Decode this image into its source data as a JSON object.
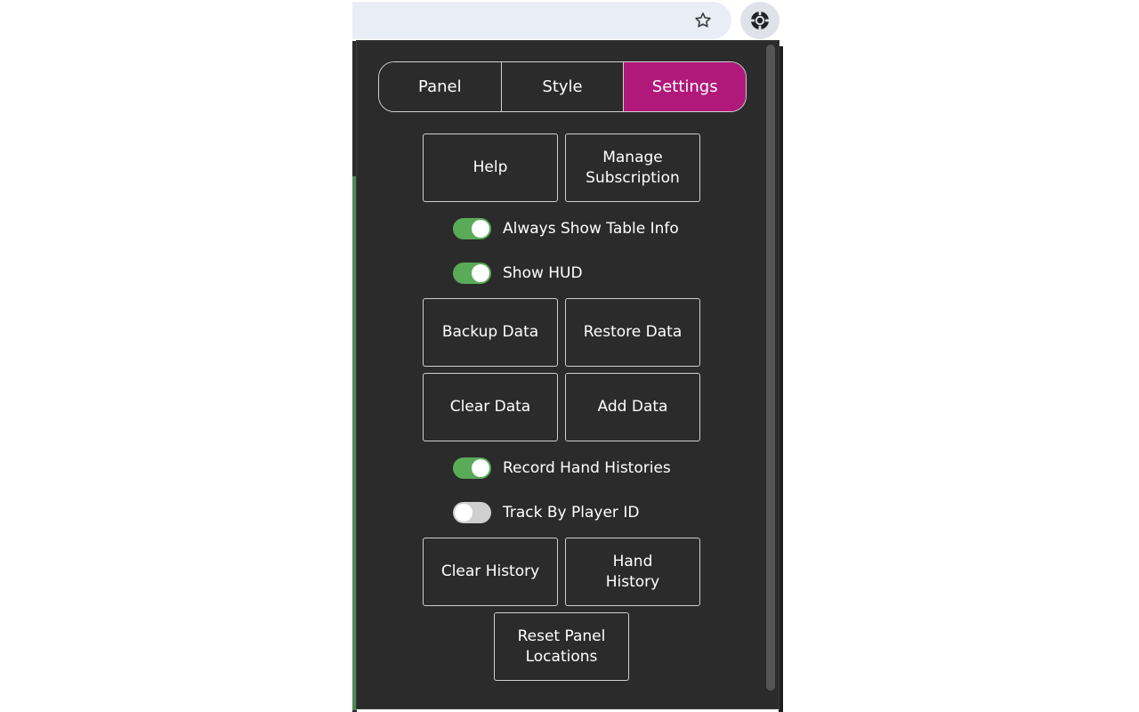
{
  "tabs": [
    {
      "label": "Panel",
      "active": false
    },
    {
      "label": "Style",
      "active": false
    },
    {
      "label": "Settings",
      "active": true
    }
  ],
  "buttons": {
    "help": "Help",
    "manage_subscription": "Manage\nSubscription",
    "backup_data": "Backup Data",
    "restore_data": "Restore Data",
    "clear_data": "Clear Data",
    "add_data": "Add Data",
    "clear_history": "Clear History",
    "hand_history": "Hand\nHistory",
    "reset_panel_locations": "Reset Panel\nLocations"
  },
  "toggles": {
    "always_show_table_info": {
      "label": "Always Show Table Info",
      "on": true
    },
    "show_hud": {
      "label": "Show HUD",
      "on": true
    },
    "record_hand_histories": {
      "label": "Record Hand Histories",
      "on": true
    },
    "track_by_player_id": {
      "label": "Track By Player ID",
      "on": false
    }
  },
  "colors": {
    "accent_active_tab": "#b0187a",
    "toggle_on": "#5aab58",
    "toggle_off": "#cfcfcf",
    "popup_background": "#2b2b2b"
  },
  "icons": {
    "bookmark": "star-icon",
    "extension": "poker-chip-icon"
  }
}
